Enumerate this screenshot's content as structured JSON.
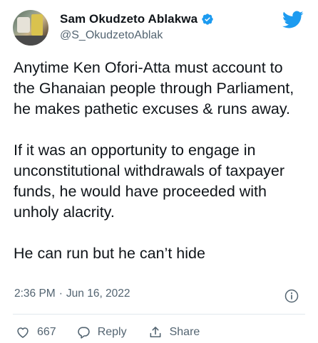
{
  "author": {
    "display_name": "Sam Okudzeto Ablakwa",
    "handle": "@S_OkudzetoAblak",
    "verified": true
  },
  "tweet": {
    "paragraphs": [
      "Anytime Ken Ofori-Atta must account to the Ghanaian people through Parliament, he makes pathetic excuses & runs away.",
      "If it was an opportunity to engage in unconstitutional withdrawals of taxpayer funds, he would have proceeded with unholy alacrity.",
      "He can run but he can’t hide"
    ],
    "time": "2:36 PM",
    "separator": "·",
    "date": "Jun 16, 2022"
  },
  "actions": {
    "like_count": "667",
    "reply_label": "Reply",
    "share_label": "Share"
  },
  "colors": {
    "twitter_blue": "#1d9bf0",
    "text": "#0f1419",
    "muted": "#536471"
  },
  "icons": [
    "verified-badge-icon",
    "twitter-bird-icon",
    "info-icon",
    "heart-icon",
    "reply-icon",
    "share-icon"
  ]
}
